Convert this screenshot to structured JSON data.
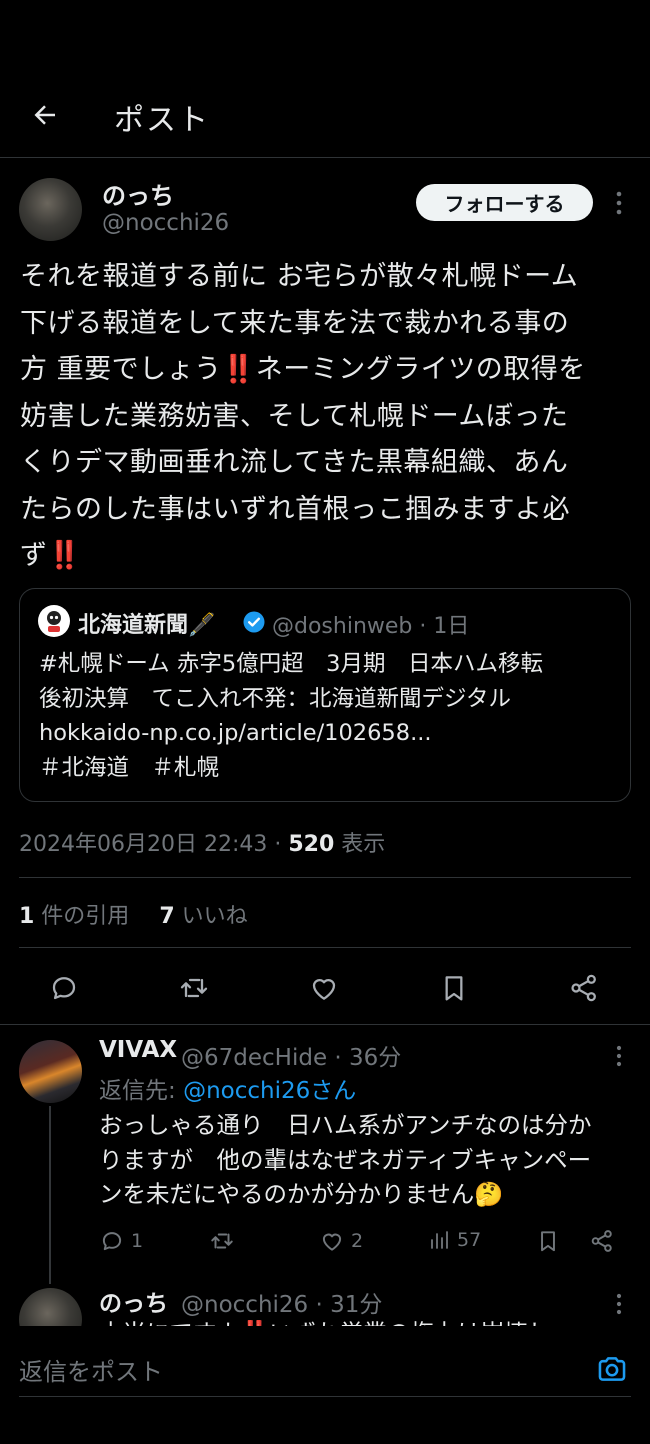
{
  "header": {
    "title": "ポスト"
  },
  "post": {
    "author_name": "のっち",
    "author_handle": "@nocchi26",
    "follow_label": "フォローする",
    "text_lines": [
      "それを報道する前に お宅らが散々札幌ドーム",
      "下げる報道をして来た事を法で裁かれる事の",
      "方 重要でしょう‼️ネーミングライツの取得を",
      "妨害した業務妨害、そして札幌ドームぼった",
      "くりデマ動画垂れ流してきた黒幕組織、あん",
      "たらのした事はいずれ首根っこ掴みますよ必",
      "ず‼️"
    ],
    "quote": {
      "name": "北海道新聞🖋️",
      "meta": "@doshinweb · 1日",
      "text_lines": [
        "#札幌ドーム 赤字5億円超　3月期　日本ハム移転",
        "後初決算　てこ入れ不発：北海道新聞デジタル",
        "hokkaido-np.co.jp/article/102658...",
        "＃北海道　＃札幌"
      ]
    },
    "timestamp": "2024年06月20日 22:43 · ",
    "views_count": "520",
    "views_label": " 表示",
    "quotes_count": "1",
    "quotes_label": " 件の引用",
    "likes_count": "7",
    "likes_label": " いいね"
  },
  "reply": {
    "name": "VIVAX",
    "meta": "@67decHide · 36分",
    "reply_to_prefix": "返信先: ",
    "reply_to_handle": "@nocchi26さん",
    "text_lines": [
      "おっしゃる通り　日ハム系がアンチなのは分か",
      "りますが　他の輩はなぜネガティブキャンペー",
      "ンを未だにやるのかが分かりません🤔"
    ],
    "reply_count": "1",
    "like_count": "2",
    "view_count": "57"
  },
  "reply2": {
    "name": "のっち",
    "meta": "@nocchi26 · 31分",
    "text": "本当にですよ‼️いずれ営業の権力は崩壊し"
  },
  "composer": {
    "placeholder": "返信をポスト"
  },
  "colors": {
    "background": "#000000",
    "text": "#e7e9ea",
    "muted": "#71767b",
    "accent": "#1d9bf0",
    "border": "#2f3336"
  },
  "icons": [
    "back-arrow-icon",
    "more-icon",
    "verified-badge-icon",
    "reply-icon",
    "repost-icon",
    "like-icon",
    "bookmark-icon",
    "share-icon",
    "views-icon",
    "image-icon"
  ]
}
